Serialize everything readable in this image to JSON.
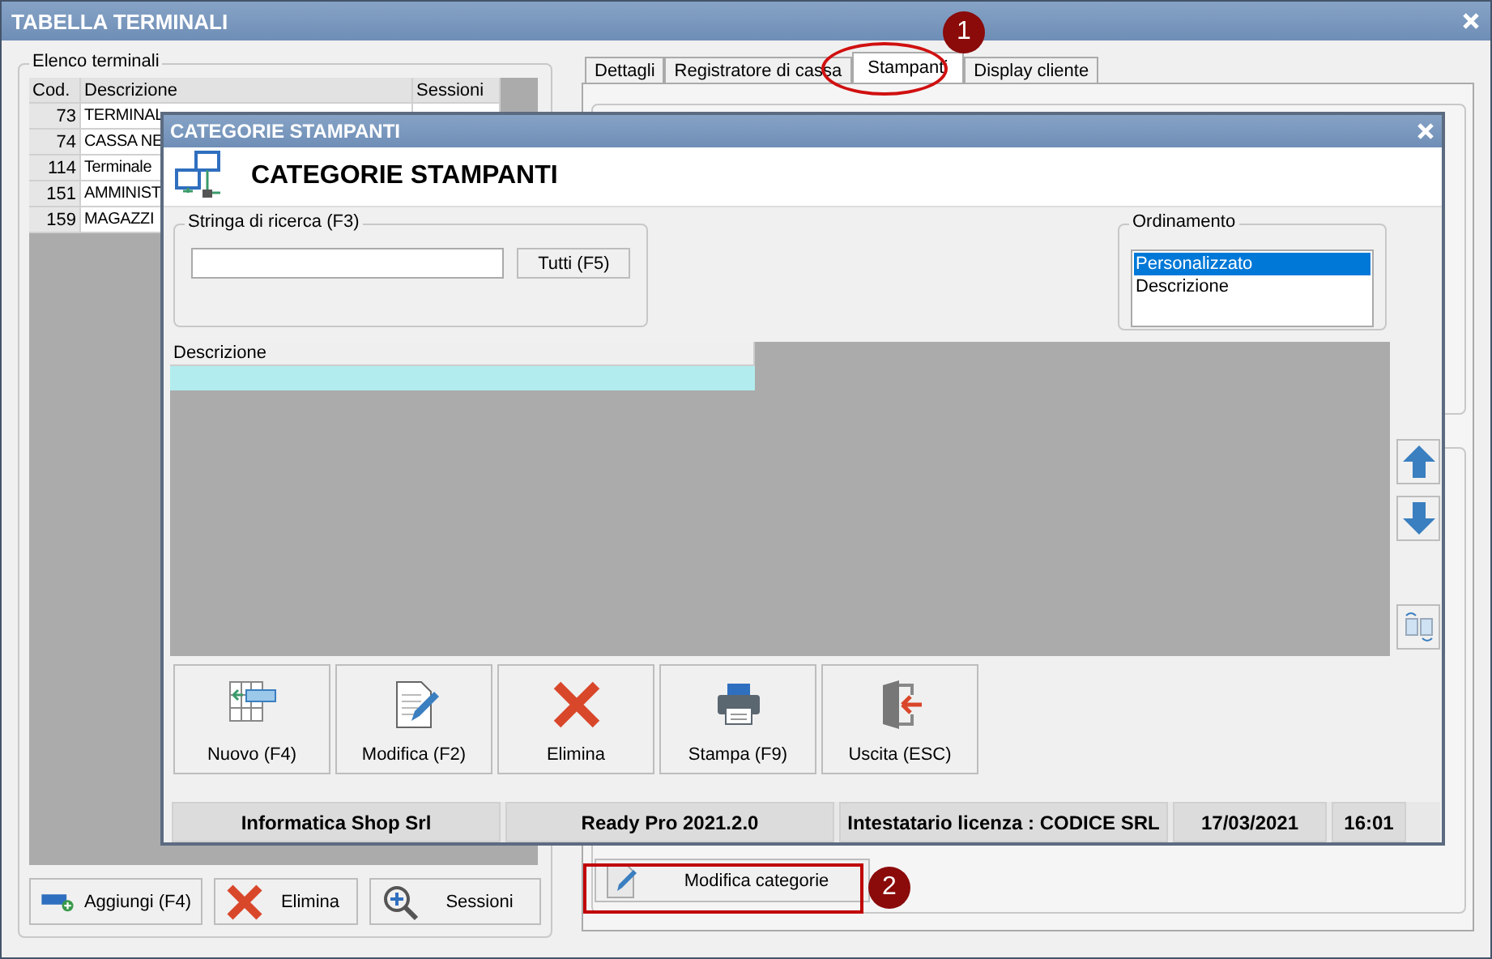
{
  "window": {
    "title": "TABELLA TERMINALI"
  },
  "terminals": {
    "group_label": "Elenco terminali",
    "columns": [
      "Cod.",
      "Descrizione",
      "Sessioni"
    ],
    "rows": [
      {
        "code": "73",
        "description": "TERMINAL"
      },
      {
        "code": "74",
        "description": "CASSA NE"
      },
      {
        "code": "114",
        "description": "Terminale"
      },
      {
        "code": "151",
        "description": "AMMINIST"
      },
      {
        "code": "159",
        "description": "MAGAZZI"
      }
    ],
    "buttons": [
      {
        "kind": "add",
        "label": "Aggiungi (F4)"
      },
      {
        "kind": "delete",
        "label": "Elimina"
      },
      {
        "kind": "zoom",
        "label": "Sessioni"
      }
    ]
  },
  "tabs": [
    {
      "label": "Dettagli",
      "selected": false
    },
    {
      "label": "Registratore di cassa",
      "selected": false
    },
    {
      "label": "Stampanti",
      "selected": true
    },
    {
      "label": "Display cliente",
      "selected": false
    }
  ],
  "modify_categories_button": "Modifica categorie",
  "annotations": [
    {
      "number": "1"
    },
    {
      "number": "2"
    }
  ],
  "dialog": {
    "title": "CATEGORIE STAMPANTI",
    "heading": "CATEGORIE STAMPANTI",
    "search": {
      "label": "Stringa di ricerca (F3)",
      "button": "Tutti (F5)"
    },
    "ordering": {
      "label": "Ordinamento",
      "items": [
        {
          "label": "Personalizzato",
          "selected": true
        },
        {
          "label": "Descrizione",
          "selected": false
        }
      ]
    },
    "grid": {
      "columns": [
        "Descrizione"
      ]
    },
    "buttons": [
      {
        "kind": "new",
        "label": "Nuovo (F4)"
      },
      {
        "kind": "edit",
        "label": "Modifica (F2)"
      },
      {
        "kind": "delete",
        "label": "Elimina"
      },
      {
        "kind": "print",
        "label": "Stampa (F9)"
      },
      {
        "kind": "exit",
        "label": "Uscita (ESC)"
      }
    ],
    "status_bar": [
      "Informatica Shop Srl",
      "Ready Pro 2021.2.0",
      "Intestatario licenza : CODICE SRL",
      "17/03/2021",
      "16:01"
    ]
  }
}
